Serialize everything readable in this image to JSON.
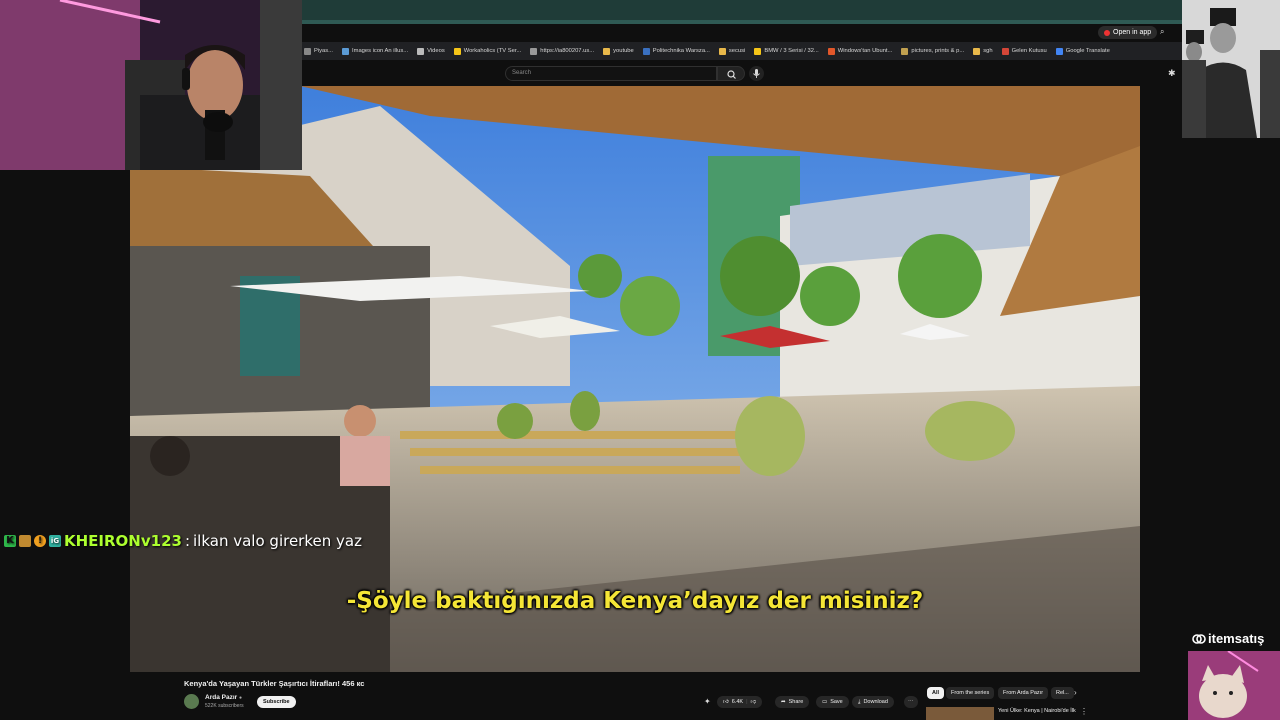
{
  "browser": {
    "open_in_app": "Open in app",
    "bookmarks": [
      {
        "label": "Piyas...",
        "color": "#888888"
      },
      {
        "label": "Images icon An illus...",
        "color": "#5b9bd5"
      },
      {
        "label": "Videos",
        "color": "#bbbbbb"
      },
      {
        "label": "Workaholics (TV Ser...",
        "color": "#f5c518"
      },
      {
        "label": "https://ia800207.us...",
        "color": "#999999"
      },
      {
        "label": "youtube",
        "color": "#e8b84a"
      },
      {
        "label": "Politechnika Warsza...",
        "color": "#3a70c0"
      },
      {
        "label": "secusi",
        "color": "#e8b84a"
      },
      {
        "label": "BMW / 3 Serisi / 32...",
        "color": "#f5c518"
      },
      {
        "label": "Windows'tan Ubunt...",
        "color": "#e2572a"
      },
      {
        "label": "pictures, prints & p...",
        "color": "#c0a050"
      },
      {
        "label": "sgh",
        "color": "#e8b84a"
      },
      {
        "label": "Gelen Kutusu",
        "color": "#d44638"
      },
      {
        "label": "Google Translate",
        "color": "#4285f4"
      }
    ]
  },
  "youtube": {
    "search_placeholder": "Search",
    "subtitle": "-Şöyle baktığınızda Kenya’dayız der misiniz?",
    "video_title": "Kenya'da Yaşayan Türkler Şaşırtıcı İtirafları! 456 кс",
    "channel_name": "Arda Pazır",
    "channel_verified": "●",
    "subscribers": "522K subscribers",
    "subscribe_label": "Subscribe",
    "like_count": "6.4K",
    "share_label": "Share",
    "save_label": "Save",
    "download_label": "Download",
    "chips": [
      "All",
      "From the series",
      "From Arda Pazır",
      "Rel..."
    ],
    "recommended_title": "Yeni Ülke: Kenya | Nairobi'de İlk"
  },
  "chat": {
    "user": "KHEIRONv123",
    "separator": ":",
    "message": "ilkan valo girerken yaz",
    "badges": [
      "#2fb84b",
      "#c08a30",
      "#f0a020",
      "#30b0a0"
    ],
    "badge_letters": [
      "K",
      "",
      "!",
      "iG"
    ]
  },
  "brand": {
    "name": "itemsatış"
  },
  "colors": {
    "subtitle": "#f5e636",
    "chat_user": "#adff2f",
    "chrome_top": "#1f3c38"
  }
}
